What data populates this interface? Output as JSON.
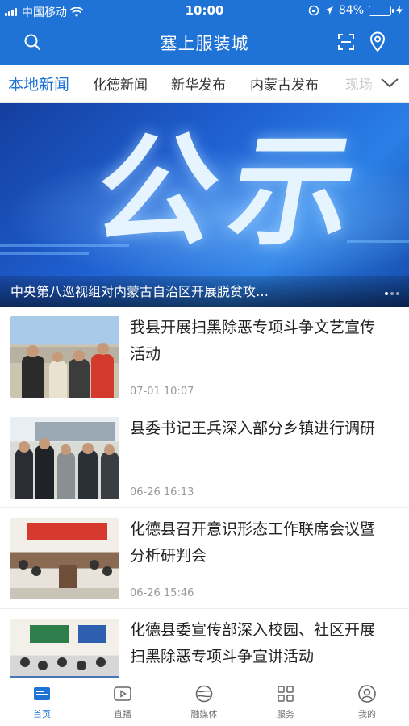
{
  "status": {
    "carrier": "中国移动",
    "time": "10:00",
    "battery": "84%",
    "battery_level": 0.84
  },
  "header": {
    "title": "塞上服装城"
  },
  "tabs": [
    {
      "label": "本地新闻",
      "active": true
    },
    {
      "label": "化德新闻"
    },
    {
      "label": "新华发布"
    },
    {
      "label": "内蒙古发布"
    },
    {
      "label": "现场"
    }
  ],
  "banner": {
    "image_text": "公示",
    "caption": "中央第八巡视组对内蒙古自治区开展脱贫攻…"
  },
  "news": [
    {
      "title": "我县开展扫黑除恶专项斗争文艺宣传活动",
      "date": "07-01 10:07"
    },
    {
      "title": "县委书记王兵深入部分乡镇进行调研",
      "date": "06-26 16:13"
    },
    {
      "title": "化德县召开意识形态工作联席会议暨分析研判会",
      "date": "06-26 15:46"
    },
    {
      "title": "化德县委宣传部深入校园、社区开展扫黑除恶专项斗争宣讲活动",
      "date": ""
    }
  ],
  "bottom_nav": [
    {
      "label": "首页",
      "icon": "home-icon",
      "active": true
    },
    {
      "label": "直播",
      "icon": "live-icon"
    },
    {
      "label": "融媒体",
      "icon": "media-icon"
    },
    {
      "label": "服务",
      "icon": "service-icon"
    },
    {
      "label": "我的",
      "icon": "profile-icon"
    }
  ],
  "colors": {
    "primary": "#1f73d6",
    "battery": "#4cd964"
  }
}
